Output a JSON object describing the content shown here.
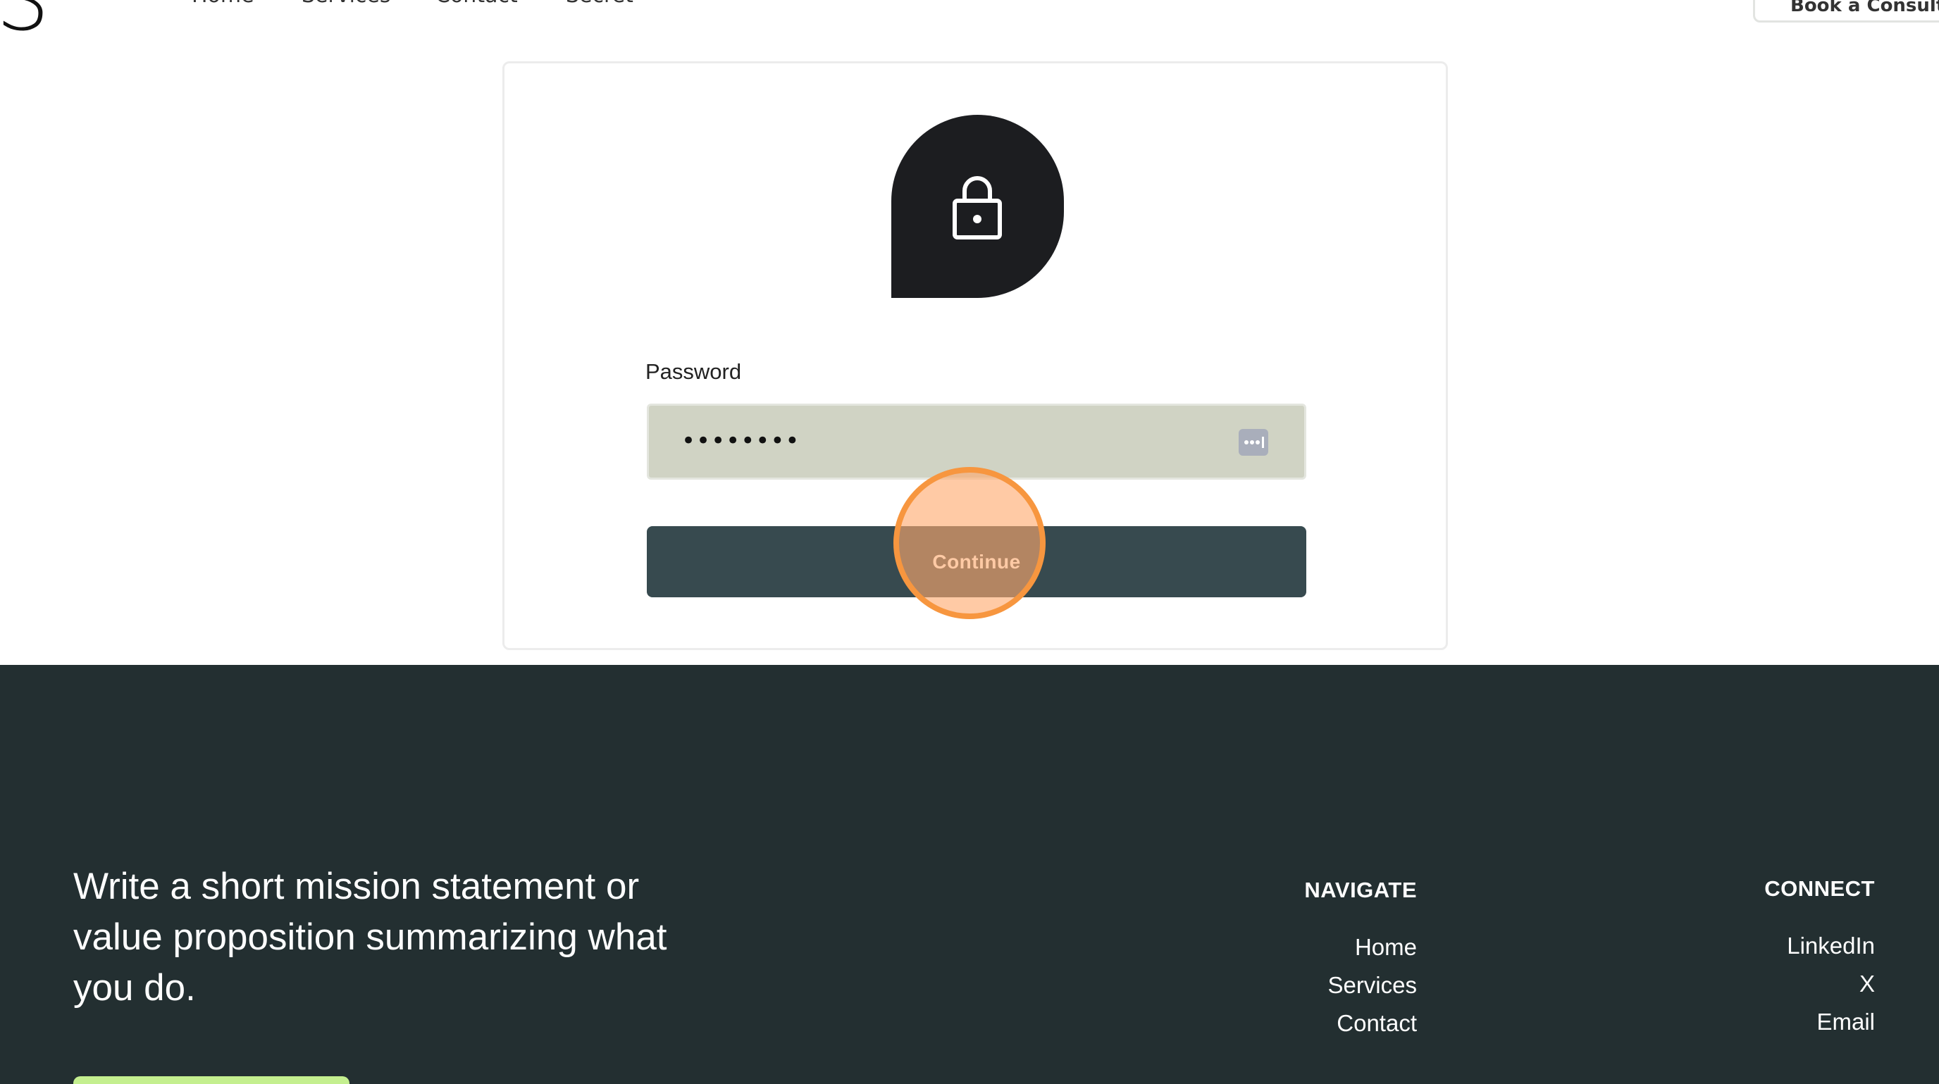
{
  "header": {
    "logo_letter": "S",
    "nav": [
      "Home",
      "Services",
      "Contact",
      "Secret"
    ],
    "cta_label": "Book a Consultation"
  },
  "password_page": {
    "label": "Password",
    "masked_value": "••••••••",
    "continue_label": "Continue",
    "lock_icon": "lock-icon",
    "manager_icon": "password-manager-icon"
  },
  "footer": {
    "mission": "Write a short mission statement or value proposition summarizing what you do.",
    "navigate": {
      "heading": "NAVIGATE",
      "links": [
        "Home",
        "Services",
        "Contact"
      ]
    },
    "connect": {
      "heading": "CONNECT",
      "links": [
        "LinkedIn",
        "X",
        "Email"
      ]
    }
  },
  "colors": {
    "footer_bg": "#232f31",
    "button_bg": "#374a4f",
    "input_bg": "#d0d3c4",
    "lock_badge": "#1c1d20",
    "click_marker": "#f7963f",
    "footer_cta": "#c4ef8f"
  }
}
